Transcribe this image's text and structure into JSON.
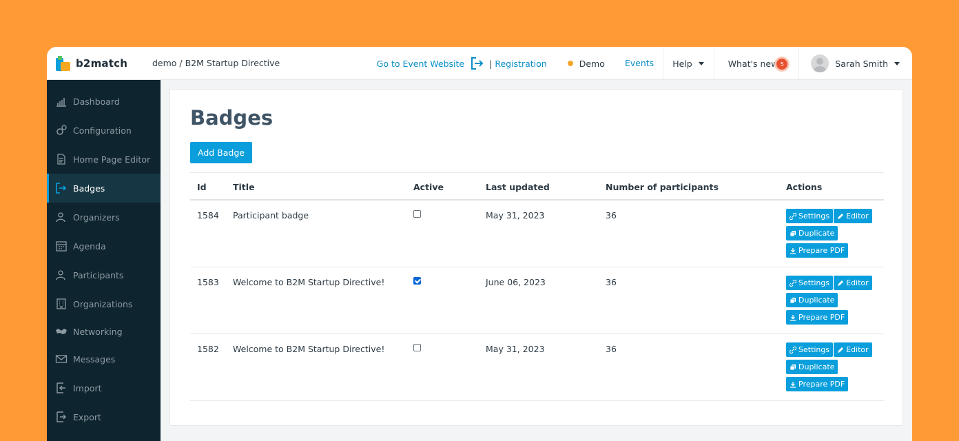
{
  "brand": {
    "name": "b2match"
  },
  "breadcrumb": "demo / B2M Startup Directive",
  "header": {
    "event_site": "Go to Event Website",
    "separator": "|",
    "registration": "Registration",
    "demo": "Demo",
    "events": "Events",
    "help": "Help",
    "whats_new": "What's new",
    "whats_new_count": "5",
    "user": "Sarah Smith"
  },
  "sidebar": {
    "items": [
      {
        "label": "Dashboard",
        "icon": "chart-icon"
      },
      {
        "label": "Configuration",
        "icon": "gear-icon"
      },
      {
        "label": "Home Page Editor",
        "icon": "document-icon"
      },
      {
        "label": "Badges",
        "icon": "badge-exit-icon"
      },
      {
        "label": "Organizers",
        "icon": "users-icon"
      },
      {
        "label": "Agenda",
        "icon": "calendar-icon"
      },
      {
        "label": "Participants",
        "icon": "users-icon"
      },
      {
        "label": "Organizations",
        "icon": "building-icon"
      },
      {
        "label": "Networking",
        "icon": "handshake-icon"
      },
      {
        "label": "Messages",
        "icon": "envelope-icon"
      },
      {
        "label": "Import",
        "icon": "import-icon"
      },
      {
        "label": "Export",
        "icon": "export-icon"
      }
    ]
  },
  "page": {
    "title": "Badges",
    "add_button": "Add Badge"
  },
  "table": {
    "columns": [
      "Id",
      "Title",
      "Active",
      "Last updated",
      "Number of participants",
      "Actions"
    ],
    "rows": [
      {
        "id": "1584",
        "title": "Participant badge",
        "active": false,
        "updated": "May 31, 2023",
        "participants": "36"
      },
      {
        "id": "1583",
        "title": "Welcome to B2M Startup Directive!",
        "active": true,
        "updated": "June 06, 2023",
        "participants": "36"
      },
      {
        "id": "1582",
        "title": "Welcome to B2M Startup Directive!",
        "active": false,
        "updated": "May 31, 2023",
        "participants": "36"
      }
    ],
    "actions": {
      "settings": "Settings",
      "editor": "Editor",
      "duplicate": "Duplicate",
      "pdf": "Prepare PDF"
    }
  },
  "colors": {
    "accent": "#0a9fdc",
    "sidebar": "#0e2530",
    "background": "#FF9A35",
    "dot": "#f4a52a",
    "badge": "#e8502f"
  }
}
